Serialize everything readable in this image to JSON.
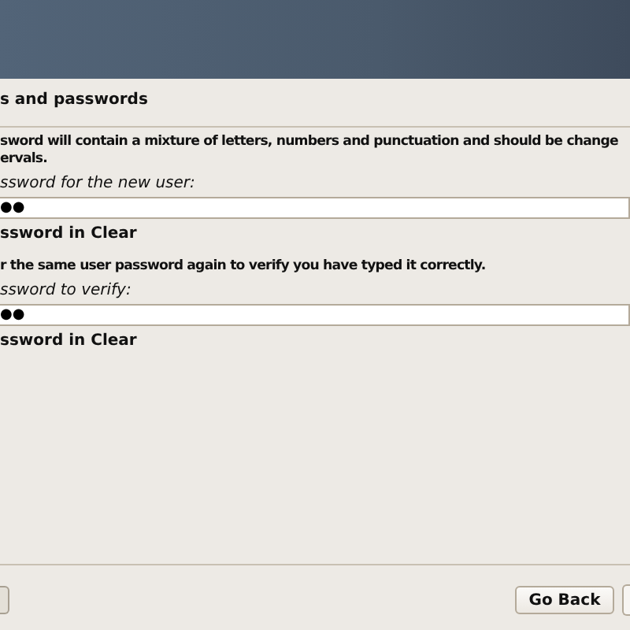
{
  "title": "s and passwords",
  "description": "sword will contain a mixture of letters, numbers and punctuation and should be change",
  "description_2": "ervals.",
  "fields": [
    {
      "label": "ssword for the new user:",
      "value": "●●",
      "show_label": "ssword in Clear"
    },
    {
      "intro": "r the same user password again to verify you have typed it correctly.",
      "label": "ssword to verify:",
      "value": "●●",
      "show_label": "ssword in Clear"
    }
  ],
  "buttons": [
    {
      "label": "Go Back"
    }
  ]
}
